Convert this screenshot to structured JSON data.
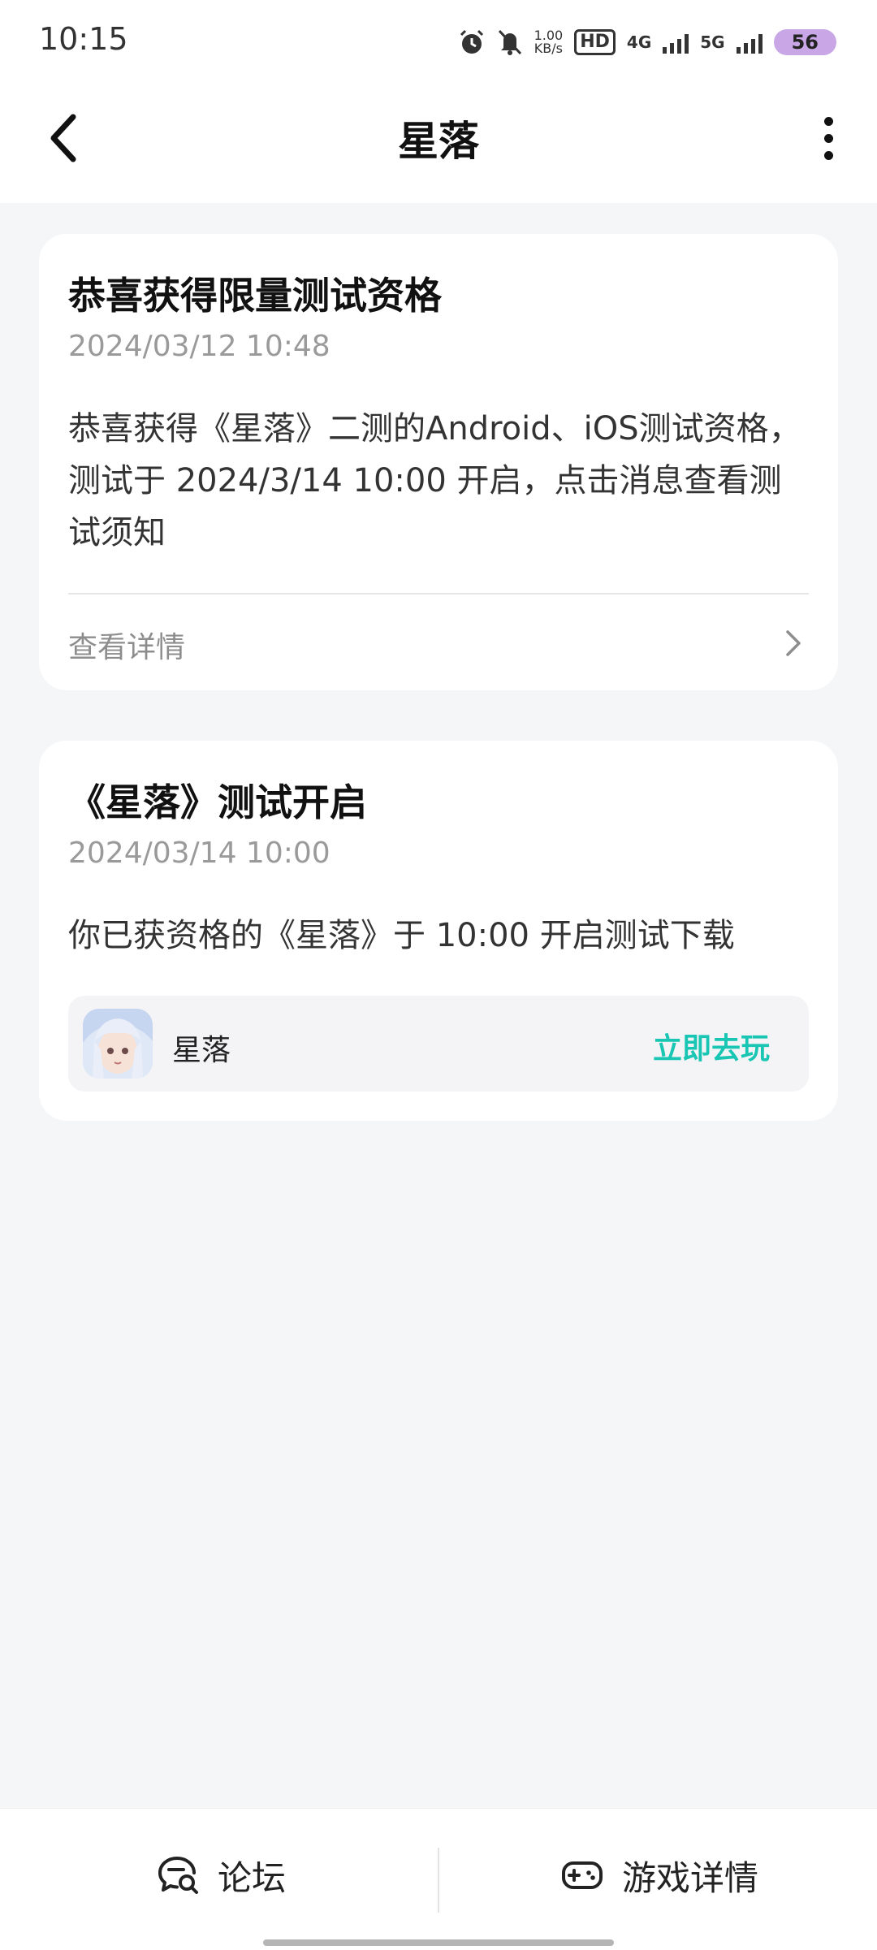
{
  "status_bar": {
    "time": "10:15",
    "speed_value": "1.00",
    "speed_unit": "KB/s",
    "hd_label": "HD",
    "net1": "4G",
    "net2": "5G",
    "battery": "56",
    "icons": [
      "alarm-icon",
      "mute-icon",
      "signal-icon"
    ]
  },
  "header": {
    "title": "星落",
    "back_icon": "chevron-left-icon",
    "more_icon": "more-vertical-icon"
  },
  "messages": [
    {
      "title": "恭喜获得限量测试资格",
      "time": "2024/03/12 10:48",
      "body": "恭喜获得《星落》二测的Android、iOS测试资格，测试于 2024/3/14 10:00 开启，点击消息查看测试须知",
      "link_label": "查看详情"
    },
    {
      "title": "《星落》测试开启",
      "time": "2024/03/14 10:00",
      "body": "你已获资格的《星落》于 10:00 开启测试下载",
      "game_name": "星落",
      "action_label": "立即去玩"
    }
  ],
  "bottom_nav": {
    "forum_label": "论坛",
    "game_detail_label": "游戏详情"
  },
  "colors": {
    "accent": "#19c6b3",
    "background": "#f5f6f8",
    "battery": "#c9a6e6"
  }
}
